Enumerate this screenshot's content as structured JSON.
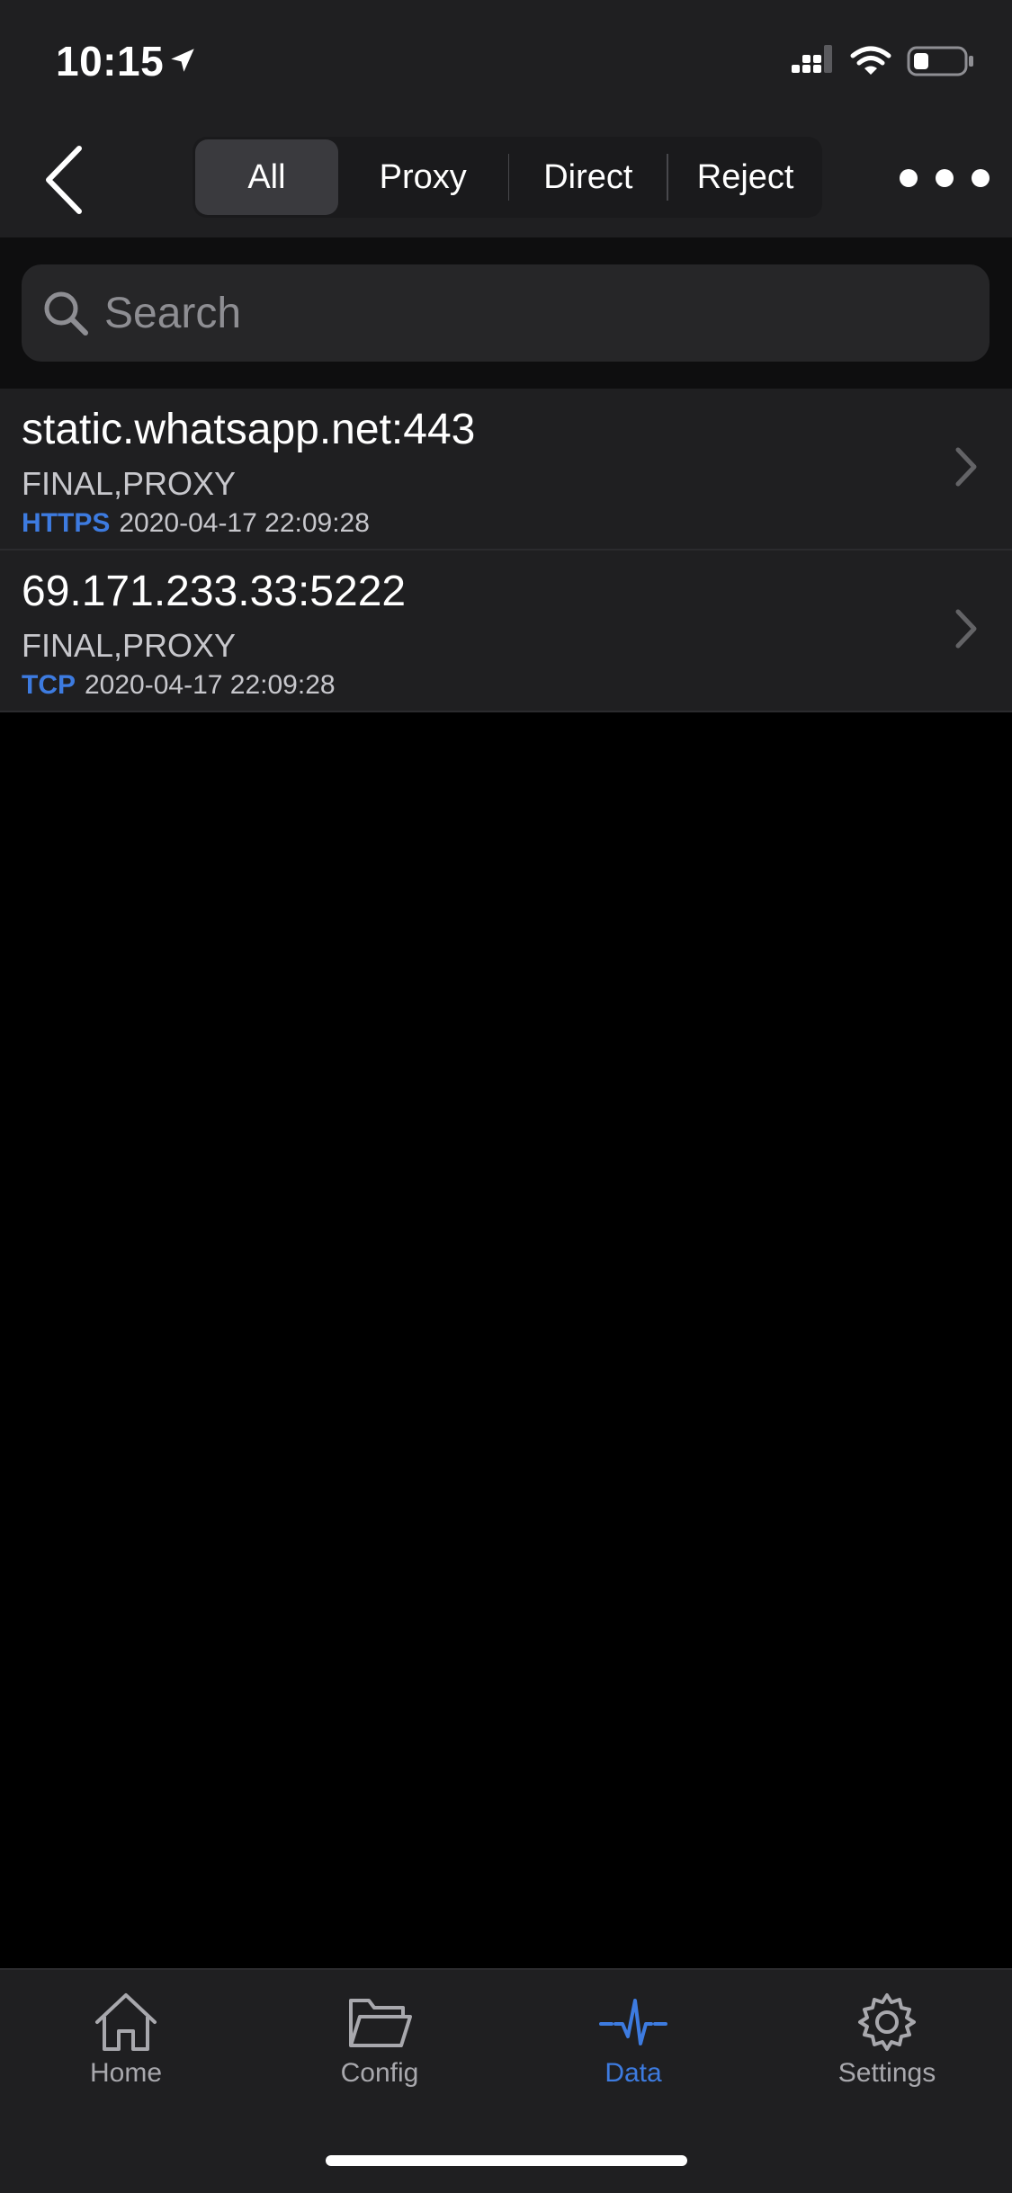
{
  "status_bar": {
    "time": "10:15",
    "icons": [
      "location-arrow-icon",
      "signal-icon",
      "wifi-icon",
      "battery-icon"
    ]
  },
  "nav": {
    "back_icon": "chevron-left-icon",
    "segments": [
      {
        "label": "All",
        "active": true
      },
      {
        "label": "Proxy",
        "active": false
      },
      {
        "label": "Direct",
        "active": false
      },
      {
        "label": "Reject",
        "active": false
      }
    ],
    "more_icon": "more-horizontal-icon"
  },
  "search": {
    "placeholder": "Search",
    "value": ""
  },
  "requests": [
    {
      "host": "static.whatsapp.net:443",
      "rule": "FINAL,PROXY",
      "protocol": "HTTPS",
      "timestamp": "2020-04-17 22:09:28"
    },
    {
      "host": "69.171.233.33:5222",
      "rule": "FINAL,PROXY",
      "protocol": "TCP",
      "timestamp": "2020-04-17 22:09:28"
    }
  ],
  "tab_bar": {
    "tabs": [
      {
        "label": "Home",
        "icon": "home-icon",
        "active": false
      },
      {
        "label": "Config",
        "icon": "folder-icon",
        "active": false
      },
      {
        "label": "Data",
        "icon": "pulse-icon",
        "active": true
      },
      {
        "label": "Settings",
        "icon": "gear-icon",
        "active": false
      }
    ]
  },
  "colors": {
    "accent": "#3d7be0",
    "bar_background": "#1f1f21",
    "page_background": "#000000"
  }
}
